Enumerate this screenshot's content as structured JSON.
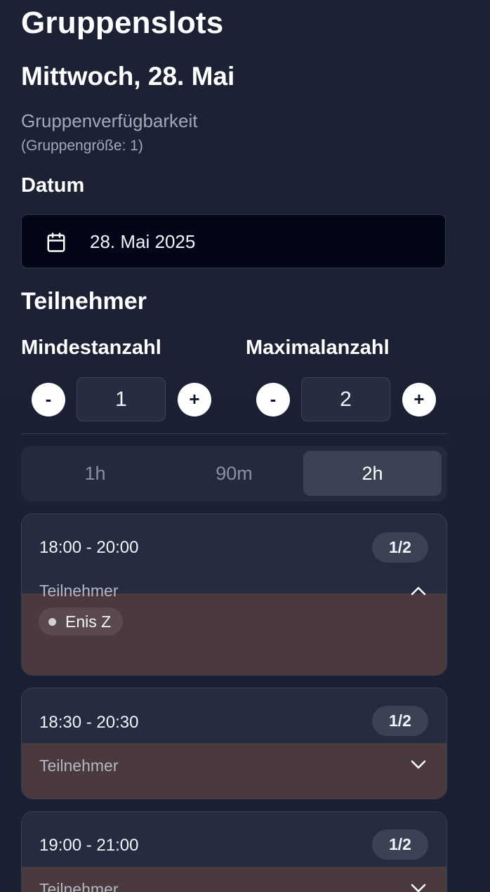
{
  "header": {
    "title": "Gruppenslots",
    "subtitle": "Mittwoch, 28. Mai",
    "availability": "Gruppenverfügbarkeit",
    "group_size": "(Gruppengröße: 1)"
  },
  "date_section": {
    "label": "Datum",
    "value": "28. Mai 2025",
    "icon": "calendar-icon"
  },
  "participants": {
    "label": "Teilnehmer",
    "min": {
      "label": "Mindestanzahl",
      "value": "1",
      "decrement": "-",
      "increment": "+"
    },
    "max": {
      "label": "Maximalanzahl",
      "value": "2",
      "decrement": "-",
      "increment": "+"
    }
  },
  "duration_tabs": {
    "options": [
      "1h",
      "90m",
      "2h"
    ],
    "selected": "2h"
  },
  "slots": [
    {
      "time": "18:00 - 20:00",
      "count": "1/2",
      "participants_label": "Teilnehmer",
      "expanded": true,
      "chevron": "chevron-up-icon",
      "participants": [
        "Enis Z"
      ]
    },
    {
      "time": "18:30 - 20:30",
      "count": "1/2",
      "participants_label": "Teilnehmer",
      "expanded": false,
      "chevron": "chevron-down-icon",
      "participants": []
    },
    {
      "time": "19:00 - 21:00",
      "count": "1/2",
      "participants_label": "Teilnehmer",
      "expanded": false,
      "chevron": "chevron-down-icon",
      "participants": []
    }
  ],
  "colors": {
    "background": "#1b2134",
    "date_field": "#020617",
    "card": "#252c40",
    "card_participants": "#4a393d",
    "badge": "#3b4254",
    "tab_active": "#3b4254"
  }
}
